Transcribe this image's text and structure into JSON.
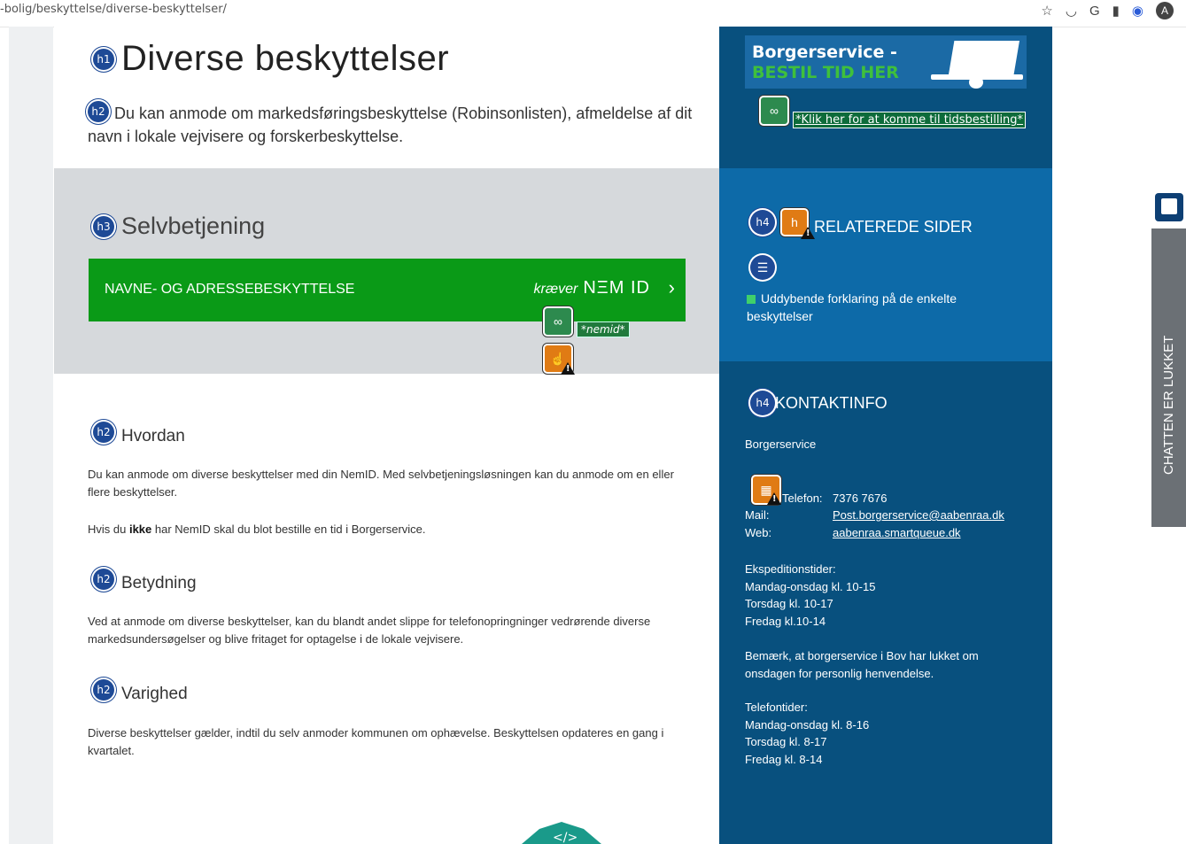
{
  "browser": {
    "url": "-bolig/beskyttelse/diverse-beskyttelser/",
    "avatar_letter": "A",
    "icons": [
      "star-icon",
      "extension-icon",
      "google-icon",
      "extension-icon-2",
      "wave-extension-icon"
    ]
  },
  "main": {
    "h1_badge": "h1",
    "title": "Diverse beskyttelser",
    "intro_badge": "h2",
    "intro": "Du kan anmode om markedsføringsbeskyttelse (Robinsonlisten), afmeldelse af dit navn i lokale vejvisere og forskerbeskyttelse.",
    "selfservice": {
      "badge": "h3",
      "heading": "Selvbetjening",
      "button_label": "NAVNE- OG ADRESSEBESKYTTELSE",
      "requires": "kræver",
      "nemid_logo": "NΞM ID",
      "chevron": "›",
      "nemid_tag": "*nemid*"
    },
    "sections": [
      {
        "badge": "h2",
        "heading": "Hvordan",
        "paragraphs": [
          "Du kan anmode om diverse beskyttelser med din NemID. Med selvbetjeningsløsningen kan du anmode om en eller flere beskyttelser."
        ],
        "p2_before": "Hvis du ",
        "p2_bold": "ikke",
        "p2_after": " har NemID skal du blot bestille en tid i Borgerservice."
      },
      {
        "badge": "h2",
        "heading": "Betydning",
        "paragraphs": [
          "Ved at anmode om diverse beskyttelser, kan du blandt andet slippe for telefonopringninger vedrørende diverse markedsundersøgelser og blive fritaget for optagelse i de lokale vejvisere."
        ]
      },
      {
        "badge": "h2",
        "heading": "Varighed",
        "paragraphs": [
          "Diverse beskyttelser gælder, indtil du selv anmoder kommunen om ophævelse. Beskyttelsen opdateres en gang i kvartalet."
        ]
      }
    ]
  },
  "sidebar": {
    "banner_title": "Borgerservice -",
    "banner_subtitle": "BESTIL TID HER",
    "booking_link": "*Klik her for at komme til tidsbestilling*",
    "related": {
      "badge": "h4",
      "heading": "RELATEREDE SIDER",
      "link": "Uddybende forklaring på de enkelte beskyttelser"
    },
    "contact": {
      "badge": "h4",
      "heading": "KONTAKTINFO",
      "org": "Borgerservice",
      "phone_label": "Telefon:",
      "phone": "7376 7676",
      "mail_label": "Mail:",
      "mail": "Post.borgerservice@aabenraa.dk",
      "web_label": "Web:",
      "web": "aabenraa.smartqueue.dk",
      "hours_title": "Ekspeditionstider:",
      "hours": [
        "Mandag-onsdag kl. 10-15",
        "Torsdag kl. 10-17",
        "Fredag kl.10-14"
      ],
      "note": "Bemærk, at borgerservice i Bov har lukket om onsdagen for personlig henvendelse.",
      "phone_hours_title": "Telefontider:",
      "phone_hours": [
        "Mandag-onsdag kl. 8-16",
        "Torsdag kl. 8-17",
        "Fredag kl. 8-14"
      ]
    }
  },
  "chat": {
    "label": "CHATTEN ER LUKKET"
  },
  "colors": {
    "sidebar_dark": "#08507e",
    "sidebar_mid": "#0d6aa8",
    "nemid_green": "#0a9a17",
    "grey_band": "#d6d9dc",
    "badge_blue": "#1e4a96"
  }
}
